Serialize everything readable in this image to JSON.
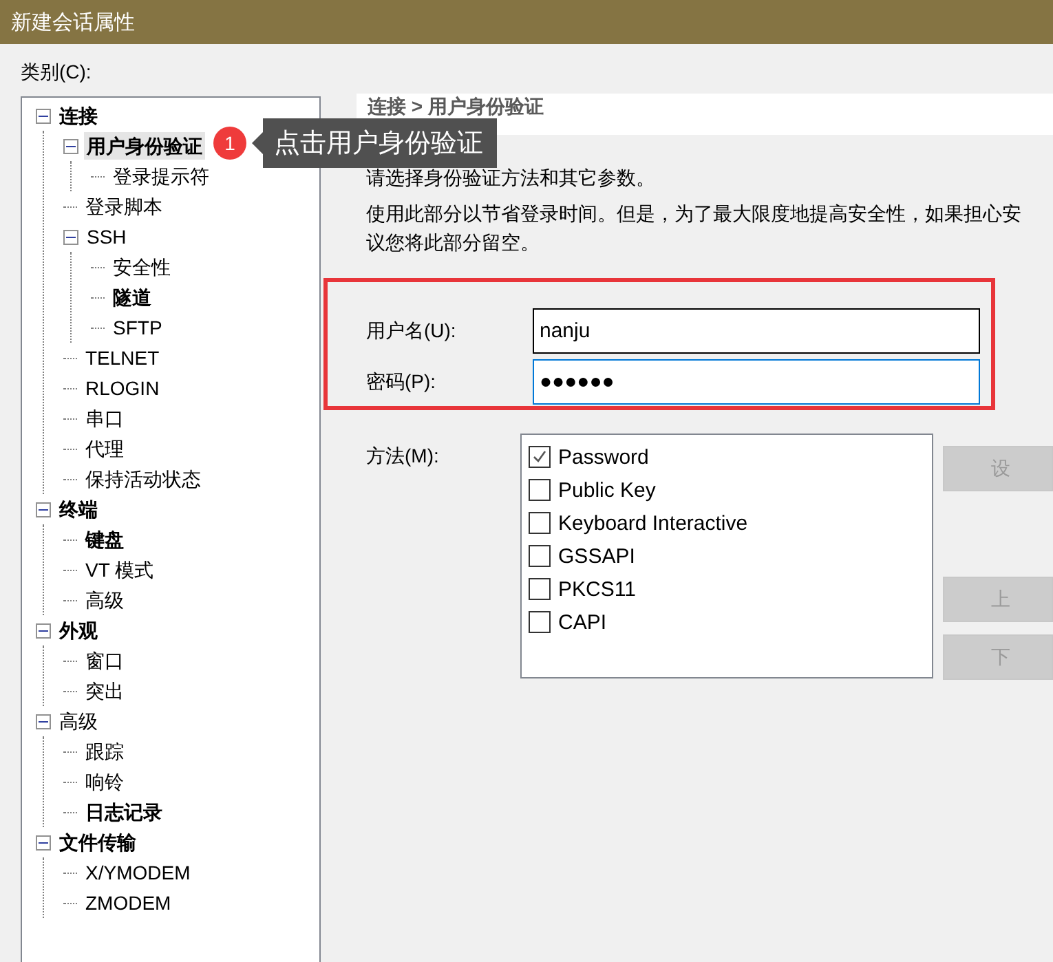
{
  "window": {
    "title": "新建会话属性"
  },
  "category_label": "类别(C):",
  "tree": [
    {
      "label": "连接",
      "bold": true,
      "selected": false,
      "expanded": true,
      "children": [
        {
          "label": "用户身份验证",
          "bold": true,
          "selected": true,
          "expanded": true,
          "children": [
            {
              "label": "登录提示符",
              "bold": false,
              "selected": false
            }
          ]
        },
        {
          "label": "登录脚本",
          "bold": false,
          "selected": false
        },
        {
          "label": "SSH",
          "bold": false,
          "selected": false,
          "expanded": true,
          "children": [
            {
              "label": "安全性",
              "bold": false,
              "selected": false
            },
            {
              "label": "隧道",
              "bold": true,
              "selected": false
            },
            {
              "label": "SFTP",
              "bold": false,
              "selected": false
            }
          ]
        },
        {
          "label": "TELNET",
          "bold": false,
          "selected": false
        },
        {
          "label": "RLOGIN",
          "bold": false,
          "selected": false
        },
        {
          "label": "串口",
          "bold": false,
          "selected": false
        },
        {
          "label": "代理",
          "bold": false,
          "selected": false
        },
        {
          "label": "保持活动状态",
          "bold": false,
          "selected": false
        }
      ]
    },
    {
      "label": "终端",
      "bold": true,
      "selected": false,
      "expanded": true,
      "children": [
        {
          "label": "键盘",
          "bold": true,
          "selected": false
        },
        {
          "label": "VT 模式",
          "bold": false,
          "selected": false
        },
        {
          "label": "高级",
          "bold": false,
          "selected": false
        }
      ]
    },
    {
      "label": "外观",
      "bold": true,
      "selected": false,
      "expanded": true,
      "children": [
        {
          "label": "窗口",
          "bold": false,
          "selected": false
        },
        {
          "label": "突出",
          "bold": false,
          "selected": false
        }
      ]
    },
    {
      "label": "高级",
      "bold": false,
      "selected": false,
      "expanded": true,
      "children": [
        {
          "label": "跟踪",
          "bold": false,
          "selected": false
        },
        {
          "label": "响铃",
          "bold": false,
          "selected": false
        },
        {
          "label": "日志记录",
          "bold": true,
          "selected": false
        }
      ]
    },
    {
      "label": "文件传输",
      "bold": true,
      "selected": false,
      "expanded": true,
      "children": [
        {
          "label": "X/YMODEM",
          "bold": false,
          "selected": false
        },
        {
          "label": "ZMODEM",
          "bold": false,
          "selected": false
        }
      ]
    }
  ],
  "callout": {
    "badge": "1",
    "text": "点击用户身份验证"
  },
  "breadcrumb": "连接 > 用户身份验证",
  "intro": "请选择身份验证方法和其它参数。",
  "description_lines": [
    "使用此部分以节省登录时间。但是，为了最大限度地提高安全性，如果担心安",
    "议您将此部分留空。"
  ],
  "fields": [
    {
      "label": "用户名(U):",
      "value": "nanju",
      "focused": false
    },
    {
      "label": "密码(P):",
      "value": "●●●●●●",
      "focused": true
    }
  ],
  "method_label": "方法(M):",
  "methods": [
    {
      "label": "Password",
      "checked": true
    },
    {
      "label": "Public Key",
      "checked": false
    },
    {
      "label": "Keyboard Interactive",
      "checked": false
    },
    {
      "label": "GSSAPI",
      "checked": false
    },
    {
      "label": "PKCS11",
      "checked": false
    },
    {
      "label": "CAPI",
      "checked": false
    }
  ],
  "side_buttons": [
    {
      "label": "设",
      "disabled": true
    },
    {
      "label": "上",
      "disabled": true
    },
    {
      "label": "下",
      "disabled": true
    }
  ]
}
